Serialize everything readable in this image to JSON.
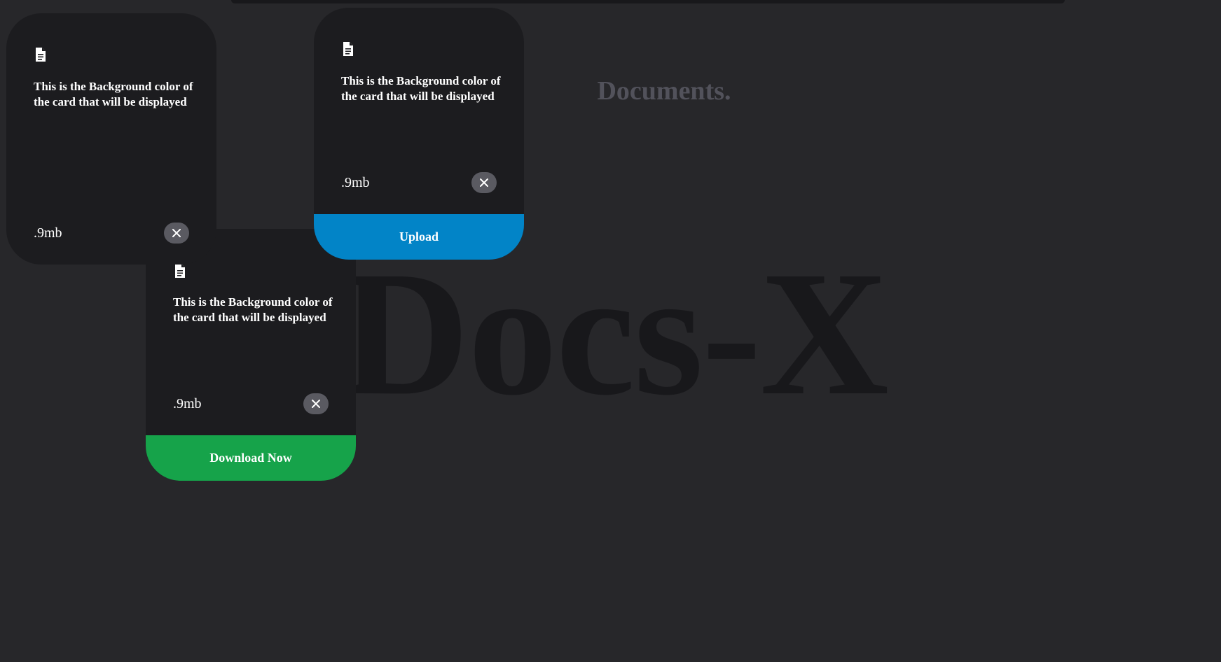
{
  "background_title": "Docs-X",
  "subtitle": "Documents.",
  "colors": {
    "page_background": "#27272a",
    "card_background": "#1c1c1f",
    "close_button": "#5a5a61",
    "upload": "#0284c7",
    "download": "#16a34a"
  },
  "cards": [
    {
      "icon": "document-icon",
      "description": "This is the Background color of the card that will be displayed",
      "size": ".9mb",
      "close_icon": "close-icon"
    },
    {
      "icon": "document-icon",
      "description": "This is the Background color of the card that will be displayed",
      "size": ".9mb",
      "close_icon": "close-icon",
      "action_label": "Upload"
    },
    {
      "icon": "document-icon",
      "description": "This is the Background color of the card that will be displayed",
      "size": ".9mb",
      "close_icon": "close-icon",
      "action_label": "Download Now"
    }
  ]
}
